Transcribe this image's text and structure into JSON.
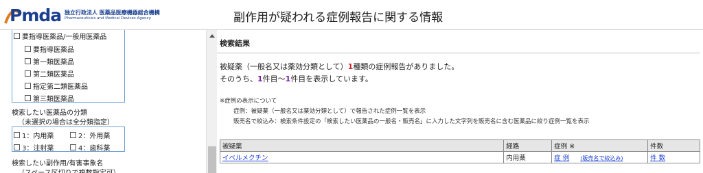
{
  "header": {
    "logo_word": "Pmda",
    "logo_jp": "独立行政法人 医薬品医療機器総合機構",
    "logo_en": "Pharmaceuticals and Medical Devices Agency",
    "title": "副作用が疑われる症例報告に関する情報"
  },
  "sidebar": {
    "group1_label": "要指導医薬品/一般用医薬品",
    "group1_items": [
      "要指導医薬品",
      "第一類医薬品",
      "第二類医薬品",
      "指定第二類医薬品",
      "第三類医薬品"
    ],
    "category_label": "検索したい医薬品の分類",
    "category_note": "（未選択の場合は全分類指定）",
    "category_options": [
      "1：内用薬",
      "2：外用薬",
      "3：注射薬",
      "4：歯科薬"
    ],
    "event_label": "検索したい副作用/有害事象名",
    "event_note": "（スペース区切りで複数指定可）"
  },
  "results": {
    "heading": "検索結果",
    "line1_pre": "被疑薬（一般名又は薬効分類として）",
    "line1_count": "1",
    "line1_post": "種類の症例報告がありました。",
    "line2_pre": "そのうち、",
    "line2_from": "1",
    "line2_mid": "件目～",
    "line2_to": "1",
    "line2_post": "件目を表示しています。",
    "note_title": "※症例の表示について",
    "note_1": "症例：被疑薬（一般名又は薬効分類として）で報告された症例一覧を表示",
    "note_2": "販売名で絞込み：検索条件設定の「検索したい医薬品の一般名・販売名」に入力した文字列を販売名に含む医薬品に絞り症例一覧を表示"
  },
  "table": {
    "headers": [
      "被疑薬",
      "経路",
      "症例 ※",
      "件数"
    ],
    "rows": [
      {
        "drug": "イベルメクチン",
        "route": "内用薬",
        "case_link": "症 例",
        "filter_link": "(販売名で絞込み)",
        "count_link": "件 数"
      }
    ]
  }
}
